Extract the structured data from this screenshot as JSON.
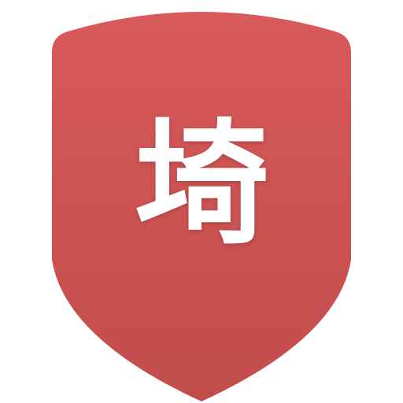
{
  "icon": {
    "name": "shield-icon",
    "character": "埼",
    "colors": {
      "top": "#d85a5a",
      "bottom": "#c24c4c",
      "glyph": "#ffffff"
    }
  }
}
